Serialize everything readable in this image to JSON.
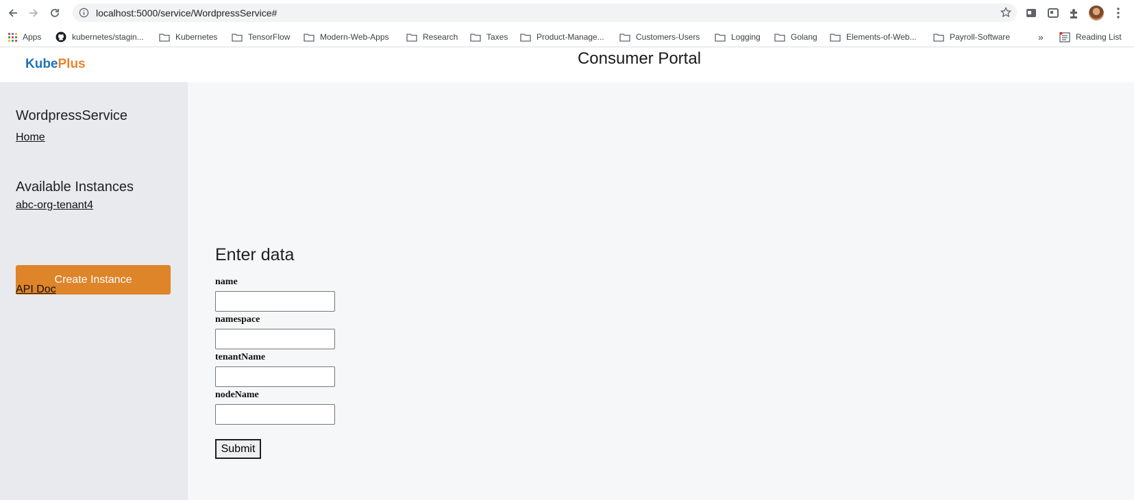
{
  "browser": {
    "url": "localhost:5000/service/WordpressService#",
    "bookmarks": [
      {
        "label": "Apps",
        "icon": "apps-grid-icon"
      },
      {
        "label": "kubernetes/stagin...",
        "icon": "github-icon"
      },
      {
        "label": "Kubernetes",
        "icon": "folder-icon"
      },
      {
        "label": "TensorFlow",
        "icon": "folder-icon"
      },
      {
        "label": "Modern-Web-Apps",
        "icon": "folder-icon"
      },
      {
        "label": "Research",
        "icon": "folder-icon"
      },
      {
        "label": "Taxes",
        "icon": "folder-icon"
      },
      {
        "label": "Product-Manage...",
        "icon": "folder-icon"
      },
      {
        "label": "Customers-Users",
        "icon": "folder-icon"
      },
      {
        "label": "Logging",
        "icon": "folder-icon"
      },
      {
        "label": "Golang",
        "icon": "folder-icon"
      },
      {
        "label": "Elements-of-Web...",
        "icon": "folder-icon"
      },
      {
        "label": "Payroll-Software",
        "icon": "folder-icon"
      }
    ],
    "overflow": "»",
    "reading_list": "Reading List"
  },
  "header": {
    "logo_kube": "Kube",
    "logo_plus": "Plus",
    "title": "Consumer Portal"
  },
  "sidebar": {
    "service_name": "WordpressService",
    "home_link": "Home",
    "instances_heading": "Available Instances",
    "instances": [
      "abc-org-tenant4"
    ],
    "create_button": "Create Instance",
    "api_doc_link": "API Doc"
  },
  "form": {
    "title": "Enter data",
    "fields": [
      {
        "label": "name",
        "value": ""
      },
      {
        "label": "namespace",
        "value": ""
      },
      {
        "label": "tenantName",
        "value": ""
      },
      {
        "label": "nodeName",
        "value": ""
      }
    ],
    "submit_label": "Submit"
  },
  "colors": {
    "brand_blue": "#1d72b8",
    "brand_orange": "#e8832a",
    "create_button": "#de8429",
    "sidebar_bg": "#e8eaed",
    "main_bg": "#f6f7f9"
  }
}
